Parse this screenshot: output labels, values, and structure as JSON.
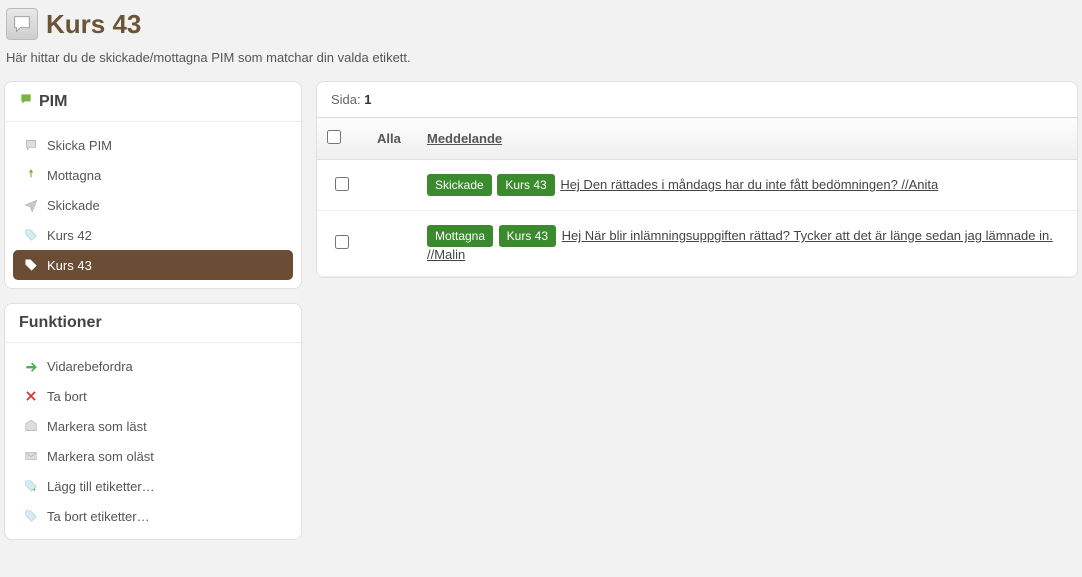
{
  "header": {
    "title": "Kurs 43",
    "subtitle": "Här hittar du de skickade/mottagna PIM som matchar din valda etikett."
  },
  "sidebar": {
    "pim": {
      "title": "PIM",
      "items": [
        {
          "label": "Skicka PIM",
          "icon": "compose"
        },
        {
          "label": "Mottagna",
          "icon": "inbox"
        },
        {
          "label": "Skickade",
          "icon": "sent"
        },
        {
          "label": "Kurs 42",
          "icon": "tag"
        },
        {
          "label": "Kurs 43",
          "icon": "tag",
          "active": true
        }
      ]
    },
    "functions": {
      "title": "Funktioner",
      "items": [
        {
          "label": "Vidarebefordra",
          "icon": "forward"
        },
        {
          "label": "Ta bort",
          "icon": "delete"
        },
        {
          "label": "Markera som läst",
          "icon": "read"
        },
        {
          "label": "Markera som oläst",
          "icon": "unread"
        },
        {
          "label": "Lägg till etiketter…",
          "icon": "tag-add"
        },
        {
          "label": "Ta bort etiketter…",
          "icon": "tag-remove"
        }
      ]
    }
  },
  "main": {
    "pager": {
      "prefix": "Sida:",
      "current": "1"
    },
    "columns": {
      "all": "Alla",
      "message": "Meddelande"
    },
    "messages": [
      {
        "badges": [
          "Skickade",
          "Kurs 43"
        ],
        "text": "Hej Den rättades i måndags har du inte fått bedömningen? //Anita"
      },
      {
        "badges": [
          "Mottagna",
          "Kurs 43"
        ],
        "text": "Hej När blir inlämningsuppgiften rättad? Tycker att det är länge sedan jag lämnade in. //Malin"
      }
    ]
  }
}
